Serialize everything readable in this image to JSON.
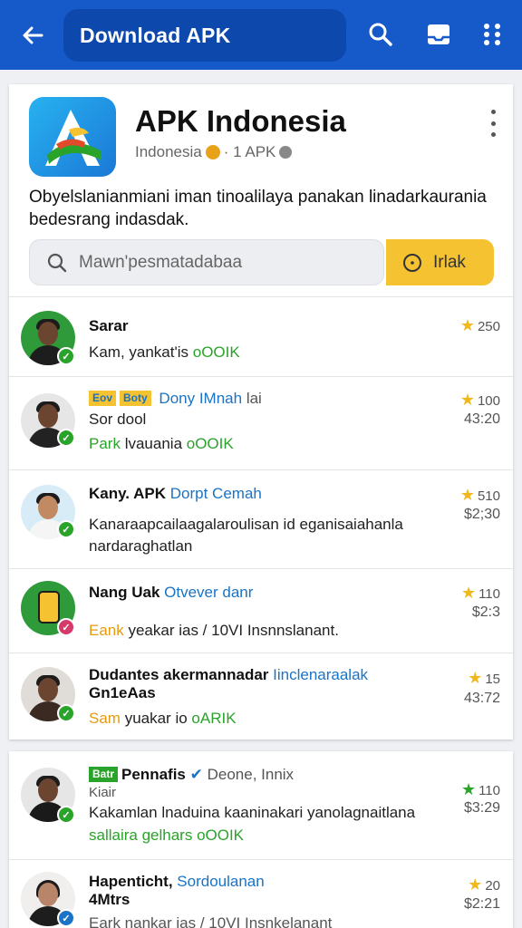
{
  "appbar": {
    "title": "Download APK",
    "back_icon": "arrow-left-icon",
    "actions": [
      "search-icon",
      "inbox-icon",
      "grid-dots-icon"
    ],
    "color": "#1659c8"
  },
  "app": {
    "name": "APK Indonesia",
    "sub_left": "Indonesia",
    "sub_right": "· 1 APK",
    "description": "Obyelslanianmiani iman tinoalilaya panakan linadarkaurania bedesrang indasdak.",
    "search_placeholder": "Mawn'pesmatadabaa",
    "action_label": "Irlak",
    "accent": "#f5c232"
  },
  "rows": [
    {
      "title": "Sarar",
      "line1": "Kam, yankat'is ",
      "line1_accent": "oOOIK",
      "rating": "250"
    },
    {
      "tags": [
        "Eov",
        "Boty"
      ],
      "link": "Dony IMnah",
      "suffix": "lai",
      "line1": "Sor dool",
      "line2_lead": "Park",
      "line2": " lvauania ",
      "line2_accent": "oOOIK",
      "rating": "100",
      "price": "43:20"
    },
    {
      "title": "Kany. APK",
      "link": "Dorpt Cemah",
      "line1": "Kanaraapcailaagalaroulisan id eganisaiahanla",
      "line2": "nardaraghatlan",
      "rating": "510",
      "price": "$2;30"
    },
    {
      "title": "Nang Uak",
      "link": "Otvever danr",
      "line1_lead": "Eank",
      "line1": " yeakar ias / 10VI Insnnslanant.",
      "rating": "110",
      "price": "$2:3"
    },
    {
      "title": "Dudantes akermannadar",
      "link": "Iinclenaraalak",
      "line1": "Gn1eAas",
      "line2_lead": "Sam",
      "line2": " yuakar io ",
      "line2_accent": "oARIK",
      "rating": "15",
      "price": "43:72"
    }
  ],
  "rows2": [
    {
      "tags": [
        "Batr"
      ],
      "title": "Pennafis",
      "suffix": "Deone, Innix",
      "line0": "Kiair",
      "line1": "Kakamlan lnaduina kaaninakari yanolagnaitlana",
      "line2": "sallaira gelhars ",
      "line2_accent": "oOOIK",
      "rating": "110",
      "price": "$3:29"
    },
    {
      "title": "Hapenticht,",
      "link": "Sordoulanan",
      "line1": "4Mtrs",
      "line2": "Eark  nankar ias / 10VI Insnkelanant",
      "rating": "20",
      "price": "$2:21"
    }
  ]
}
